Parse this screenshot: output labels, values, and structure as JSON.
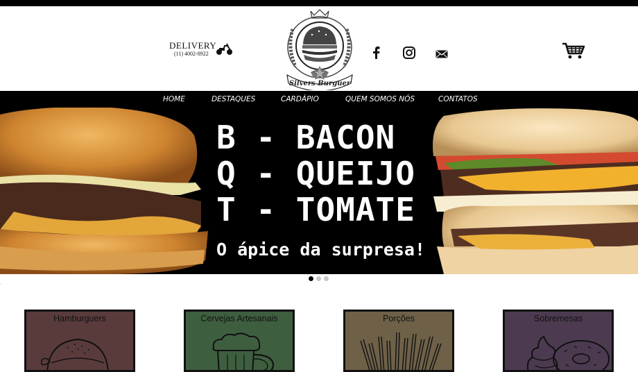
{
  "header": {
    "delivery_label": "DELIVERY",
    "delivery_phone": "(11) 4002-8922",
    "logo_text": "Silvers Burguer",
    "social": [
      {
        "name": "facebook",
        "icon": "facebook-icon"
      },
      {
        "name": "instagram",
        "icon": "instagram-icon"
      },
      {
        "name": "email",
        "icon": "mail-icon"
      }
    ],
    "cart_icon": "shopping-cart-icon"
  },
  "nav": {
    "items": [
      "HOME",
      "DESTAQUES",
      "CARDÁPIO",
      "QUEM SOMOS NÓS",
      "CONTATOS"
    ]
  },
  "hero": {
    "line1": "B - BACON",
    "line2": "Q - QUEIJO",
    "line3": "T - TOMATE",
    "subtitle": "O ápice da surpresa!",
    "slides": 3,
    "active_slide": 1
  },
  "categories": [
    {
      "label": "Hamburguers",
      "bg": "#5a3b3c"
    },
    {
      "label": "Cervejas Artesanais",
      "bg": "#3e5e40"
    },
    {
      "label": "Porções",
      "bg": "#6e6148"
    },
    {
      "label": "Sobremesas",
      "bg": "#4c3b50"
    }
  ],
  "colors": {
    "bar": "#000000",
    "text_on_dark": "#ffffff",
    "dot_active": "#000000",
    "dot_inactive": "#c8c8c8"
  }
}
